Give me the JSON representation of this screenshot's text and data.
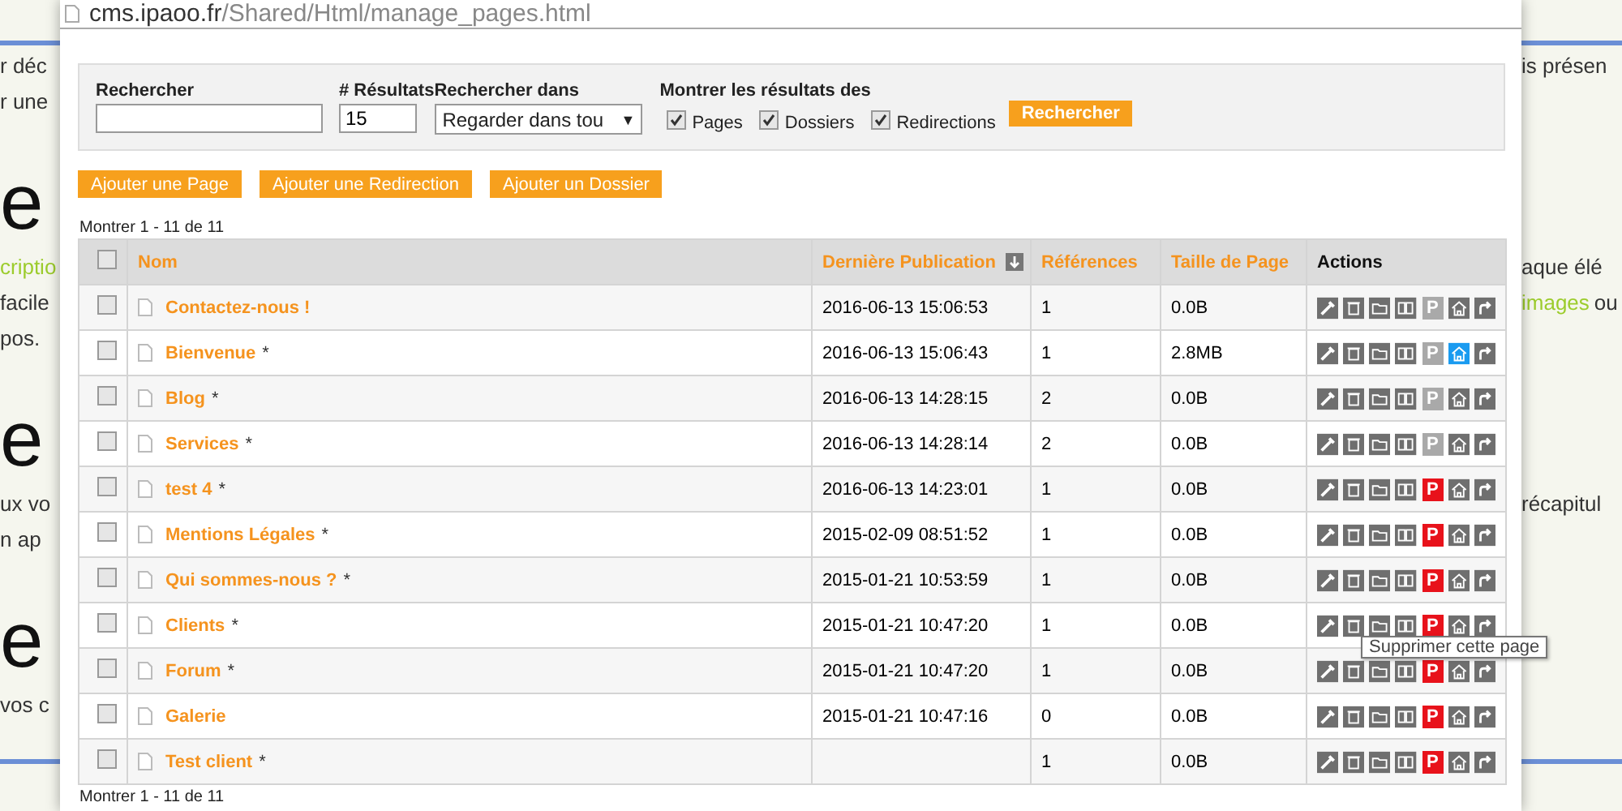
{
  "background": [
    {
      "kind": "rule"
    },
    {
      "kind": "line",
      "left": [
        {
          "text": "r déc",
          "link": false
        }
      ],
      "right": [
        {
          "text": "is présen",
          "link": false
        }
      ]
    },
    {
      "kind": "line",
      "left": [
        {
          "text": "r une",
          "link": false
        }
      ]
    },
    {
      "kind": "heading",
      "left": [
        {
          "text": "e",
          "link": false
        }
      ]
    },
    {
      "kind": "line",
      "left": [
        {
          "text": "criptio",
          "link": true
        }
      ],
      "right": [
        {
          "text": "aque élé",
          "link": false
        }
      ]
    },
    {
      "kind": "line",
      "left": [
        {
          "text": "facile",
          "link": false
        }
      ],
      "right": [
        {
          "text": "images",
          "link": true
        },
        {
          "text": "ou",
          "link": false
        }
      ]
    },
    {
      "kind": "line",
      "left": [
        {
          "text": "pos.",
          "link": false
        }
      ]
    },
    {
      "kind": "heading",
      "left": [
        {
          "text": "e",
          "link": false
        }
      ]
    },
    {
      "kind": "line",
      "left": [
        {
          "text": "ux vo",
          "link": false
        }
      ],
      "right": [
        {
          "text": "récapitul",
          "link": false
        }
      ]
    },
    {
      "kind": "line",
      "left": [
        {
          "text": "n ap",
          "link": false
        }
      ]
    },
    {
      "kind": "heading",
      "left": [
        {
          "text": "e",
          "link": false
        }
      ]
    },
    {
      "kind": "line",
      "left": [
        {
          "text": "vos c",
          "link": false
        }
      ]
    },
    {
      "kind": "rule"
    }
  ],
  "window": {
    "url_host": "cms.ipaoo.fr",
    "url_path": "/Shared/Html/manage_pages.html"
  },
  "filters": {
    "search": {
      "label": "Rechercher"
    },
    "results": {
      "label": "# Résultats",
      "value": "15"
    },
    "scope": {
      "label": "Rechercher dans",
      "value": "Regarder dans tou",
      "caret": "▼"
    },
    "show_label": "Montrer les résultats des",
    "options": [
      {
        "label": "Pages",
        "checked": true
      },
      {
        "label": "Dossiers",
        "checked": true
      },
      {
        "label": "Redirections",
        "checked": true
      }
    ],
    "button": "Rechercher"
  },
  "actions": [
    "Ajouter une Page",
    "Ajouter une Redirection",
    "Ajouter un Dossier"
  ],
  "summary_top": "Montrer 1 - 11 de 11",
  "table": {
    "all_selected": false,
    "columns": [
      "Nom",
      "Dernière Publication",
      "Références",
      "Taille de Page",
      "Actions"
    ],
    "rows": [
      {
        "selected": false,
        "name": "Contactez-nous !",
        "modified": false,
        "published_at": "2016-06-13 15:06:53",
        "references": "1",
        "size": "0.0B",
        "publish": {
          "label": "P",
          "on": false
        },
        "home": false
      },
      {
        "selected": false,
        "name": "Bienvenue",
        "modified": true,
        "published_at": "2016-06-13 15:06:43",
        "references": "1",
        "size": "2.8MB",
        "publish": {
          "label": "P",
          "on": false
        },
        "home": true
      },
      {
        "selected": false,
        "name": "Blog",
        "modified": true,
        "published_at": "2016-06-13 14:28:15",
        "references": "2",
        "size": "0.0B",
        "publish": {
          "label": "P",
          "on": false
        },
        "home": false
      },
      {
        "selected": false,
        "name": "Services",
        "modified": true,
        "published_at": "2016-06-13 14:28:14",
        "references": "2",
        "size": "0.0B",
        "publish": {
          "label": "P",
          "on": false
        },
        "home": false
      },
      {
        "selected": false,
        "name": "test 4",
        "modified": true,
        "published_at": "2016-06-13 14:23:01",
        "references": "1",
        "size": "0.0B",
        "publish": {
          "label": "P",
          "on": true
        },
        "home": false
      },
      {
        "selected": false,
        "name": "Mentions Légales",
        "modified": true,
        "published_at": "2015-02-09 08:51:52",
        "references": "1",
        "size": "0.0B",
        "publish": {
          "label": "P",
          "on": true
        },
        "home": false
      },
      {
        "selected": false,
        "name": "Qui sommes-nous ?",
        "modified": true,
        "published_at": "2015-01-21 10:53:59",
        "references": "1",
        "size": "0.0B",
        "publish": {
          "label": "P",
          "on": true
        },
        "home": false
      },
      {
        "selected": false,
        "name": "Clients",
        "modified": true,
        "published_at": "2015-01-21 10:47:20",
        "references": "1",
        "size": "0.0B",
        "publish": {
          "label": "P",
          "on": true
        },
        "home": false
      },
      {
        "selected": false,
        "name": "Forum",
        "modified": true,
        "published_at": "2015-01-21 10:47:20",
        "references": "1",
        "size": "0.0B",
        "publish": {
          "label": "P",
          "on": true
        },
        "home": false
      },
      {
        "selected": false,
        "name": "Galerie",
        "modified": false,
        "published_at": "2015-01-21 10:47:16",
        "references": "0",
        "size": "0.0B",
        "publish": {
          "label": "P",
          "on": true
        },
        "home": false
      },
      {
        "selected": false,
        "name": "Test client",
        "modified": true,
        "published_at": "",
        "references": "1",
        "size": "0.0B",
        "publish": {
          "label": "P",
          "on": true
        },
        "home": false
      }
    ]
  },
  "modified_mark": "*",
  "tooltip": "Supprimer cette page",
  "summary_bottom": "Montrer 1 - 11 de 11"
}
